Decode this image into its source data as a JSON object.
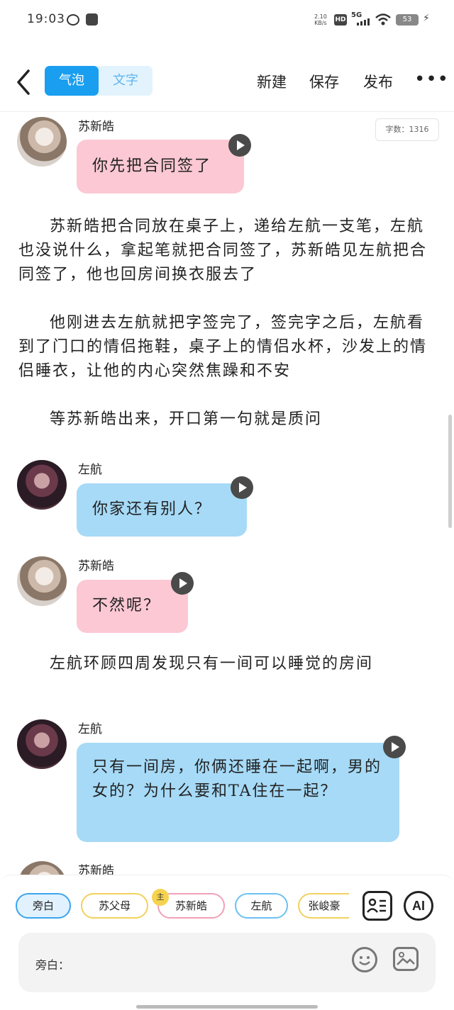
{
  "status_bar": {
    "time": "19:03",
    "net_speed_value": "2.10",
    "net_speed_unit": "KB/s",
    "hd": "HD",
    "network": "5G",
    "battery": "53"
  },
  "nav": {
    "mode_bubble": "气泡",
    "mode_text": "文字",
    "new_label": "新建",
    "save_label": "保存",
    "publish_label": "发布",
    "more_label": "•••"
  },
  "word_count": "字数：1316",
  "messages": [
    {
      "speaker": "苏新皓",
      "text": "你先把合同签了"
    },
    {
      "speaker": "左航",
      "text": "你家还有别人？"
    },
    {
      "speaker": "苏新皓",
      "text": "不然呢？"
    },
    {
      "speaker": "左航",
      "text": "只有一间房，你俩还睡在一起啊，男的女的？为什么要和TA住在一起？"
    },
    {
      "speaker": "苏新皓"
    }
  ],
  "narrations": [
    [
      "苏新皓把合同放在桌子上，递给左航一支笔，左航也没说什么，拿起笔就把合同签了，苏新皓见左航把合同签了，他也回房间换衣服去了",
      "他刚进去左航就把字签完了，签完字之后，左航看到了门口的情侣拖鞋，桌子上的情侣水杯，沙发上的情侣睡衣，让他的内心突然焦躁和不安",
      "等苏新皓出来，开口第一句就是质问"
    ],
    [
      "左航环顾四周发现只有一间可以睡觉的房间"
    ]
  ],
  "characters": [
    {
      "name": "旁白"
    },
    {
      "name": "苏父母"
    },
    {
      "name": "苏新皓",
      "badge": "主"
    },
    {
      "name": "左航"
    },
    {
      "name": "张峻豪"
    }
  ],
  "toolbar": {
    "ai_label": "AI"
  },
  "input": {
    "prefix": "旁白："
  }
}
